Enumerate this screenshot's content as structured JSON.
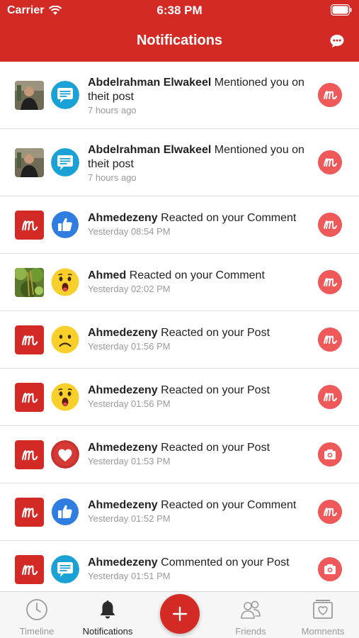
{
  "status_bar": {
    "carrier": "Carrier",
    "time": "6:38 PM"
  },
  "header": {
    "title": "Notifications",
    "right_icon": "chat-bubble-icon"
  },
  "colors": {
    "brand_red": "#d32a26",
    "badge_red": "#f0595a",
    "facebook_blue": "#2f7de1",
    "comment_teal": "#1aa1d6",
    "emoji_yellow": "#f9cf2c"
  },
  "notifications": [
    {
      "actor": "Abdelrahman Elwakeel",
      "action": "Mentioned you on theit post",
      "time": "7 hours ago",
      "avatar": "photo-man",
      "reaction": "comment-icon",
      "trailing": "moments-logo-icon"
    },
    {
      "actor": "Abdelrahman Elwakeel",
      "action": "Mentioned you on theit post",
      "time": "7 hours ago",
      "avatar": "photo-man",
      "reaction": "comment-icon",
      "trailing": "moments-logo-icon"
    },
    {
      "actor": "Ahmedezeny",
      "action": "Reacted on your Comment",
      "time": "Yesterday 08:54 PM",
      "avatar": "app-logo",
      "reaction": "like-icon",
      "trailing": "moments-logo-icon"
    },
    {
      "actor": "Ahmed",
      "action": "Reacted on your Comment",
      "time": "Yesterday 02:02 PM",
      "avatar": "photo-plant",
      "reaction": "wow-emoji-icon",
      "trailing": "moments-logo-icon"
    },
    {
      "actor": "Ahmedezeny",
      "action": "Reacted on your Post",
      "time": "Yesterday 01:56 PM",
      "avatar": "app-logo",
      "reaction": "sad-emoji-icon",
      "trailing": "moments-logo-icon"
    },
    {
      "actor": "Ahmedezeny",
      "action": "Reacted on your Post",
      "time": "Yesterday 01:56 PM",
      "avatar": "app-logo",
      "reaction": "wow-emoji-icon",
      "trailing": "moments-logo-icon"
    },
    {
      "actor": "Ahmedezeny",
      "action": "Reacted on your Post",
      "time": "Yesterday 01:53 PM",
      "avatar": "app-logo",
      "reaction": "heart-icon",
      "trailing": "camera-icon"
    },
    {
      "actor": "Ahmedezeny",
      "action": "Reacted on your Comment",
      "time": "Yesterday 01:52 PM",
      "avatar": "app-logo",
      "reaction": "like-icon",
      "trailing": "moments-logo-icon"
    },
    {
      "actor": "Ahmedezeny",
      "action": "Commented on your Post",
      "time": "Yesterday 01:51 PM",
      "avatar": "app-logo",
      "reaction": "comment-icon",
      "trailing": "camera-icon"
    }
  ],
  "tabbar": {
    "timeline": "Timeline",
    "notifications": "Notifications",
    "friends": "Friends",
    "moments": "Momnents",
    "active": "notifications"
  }
}
